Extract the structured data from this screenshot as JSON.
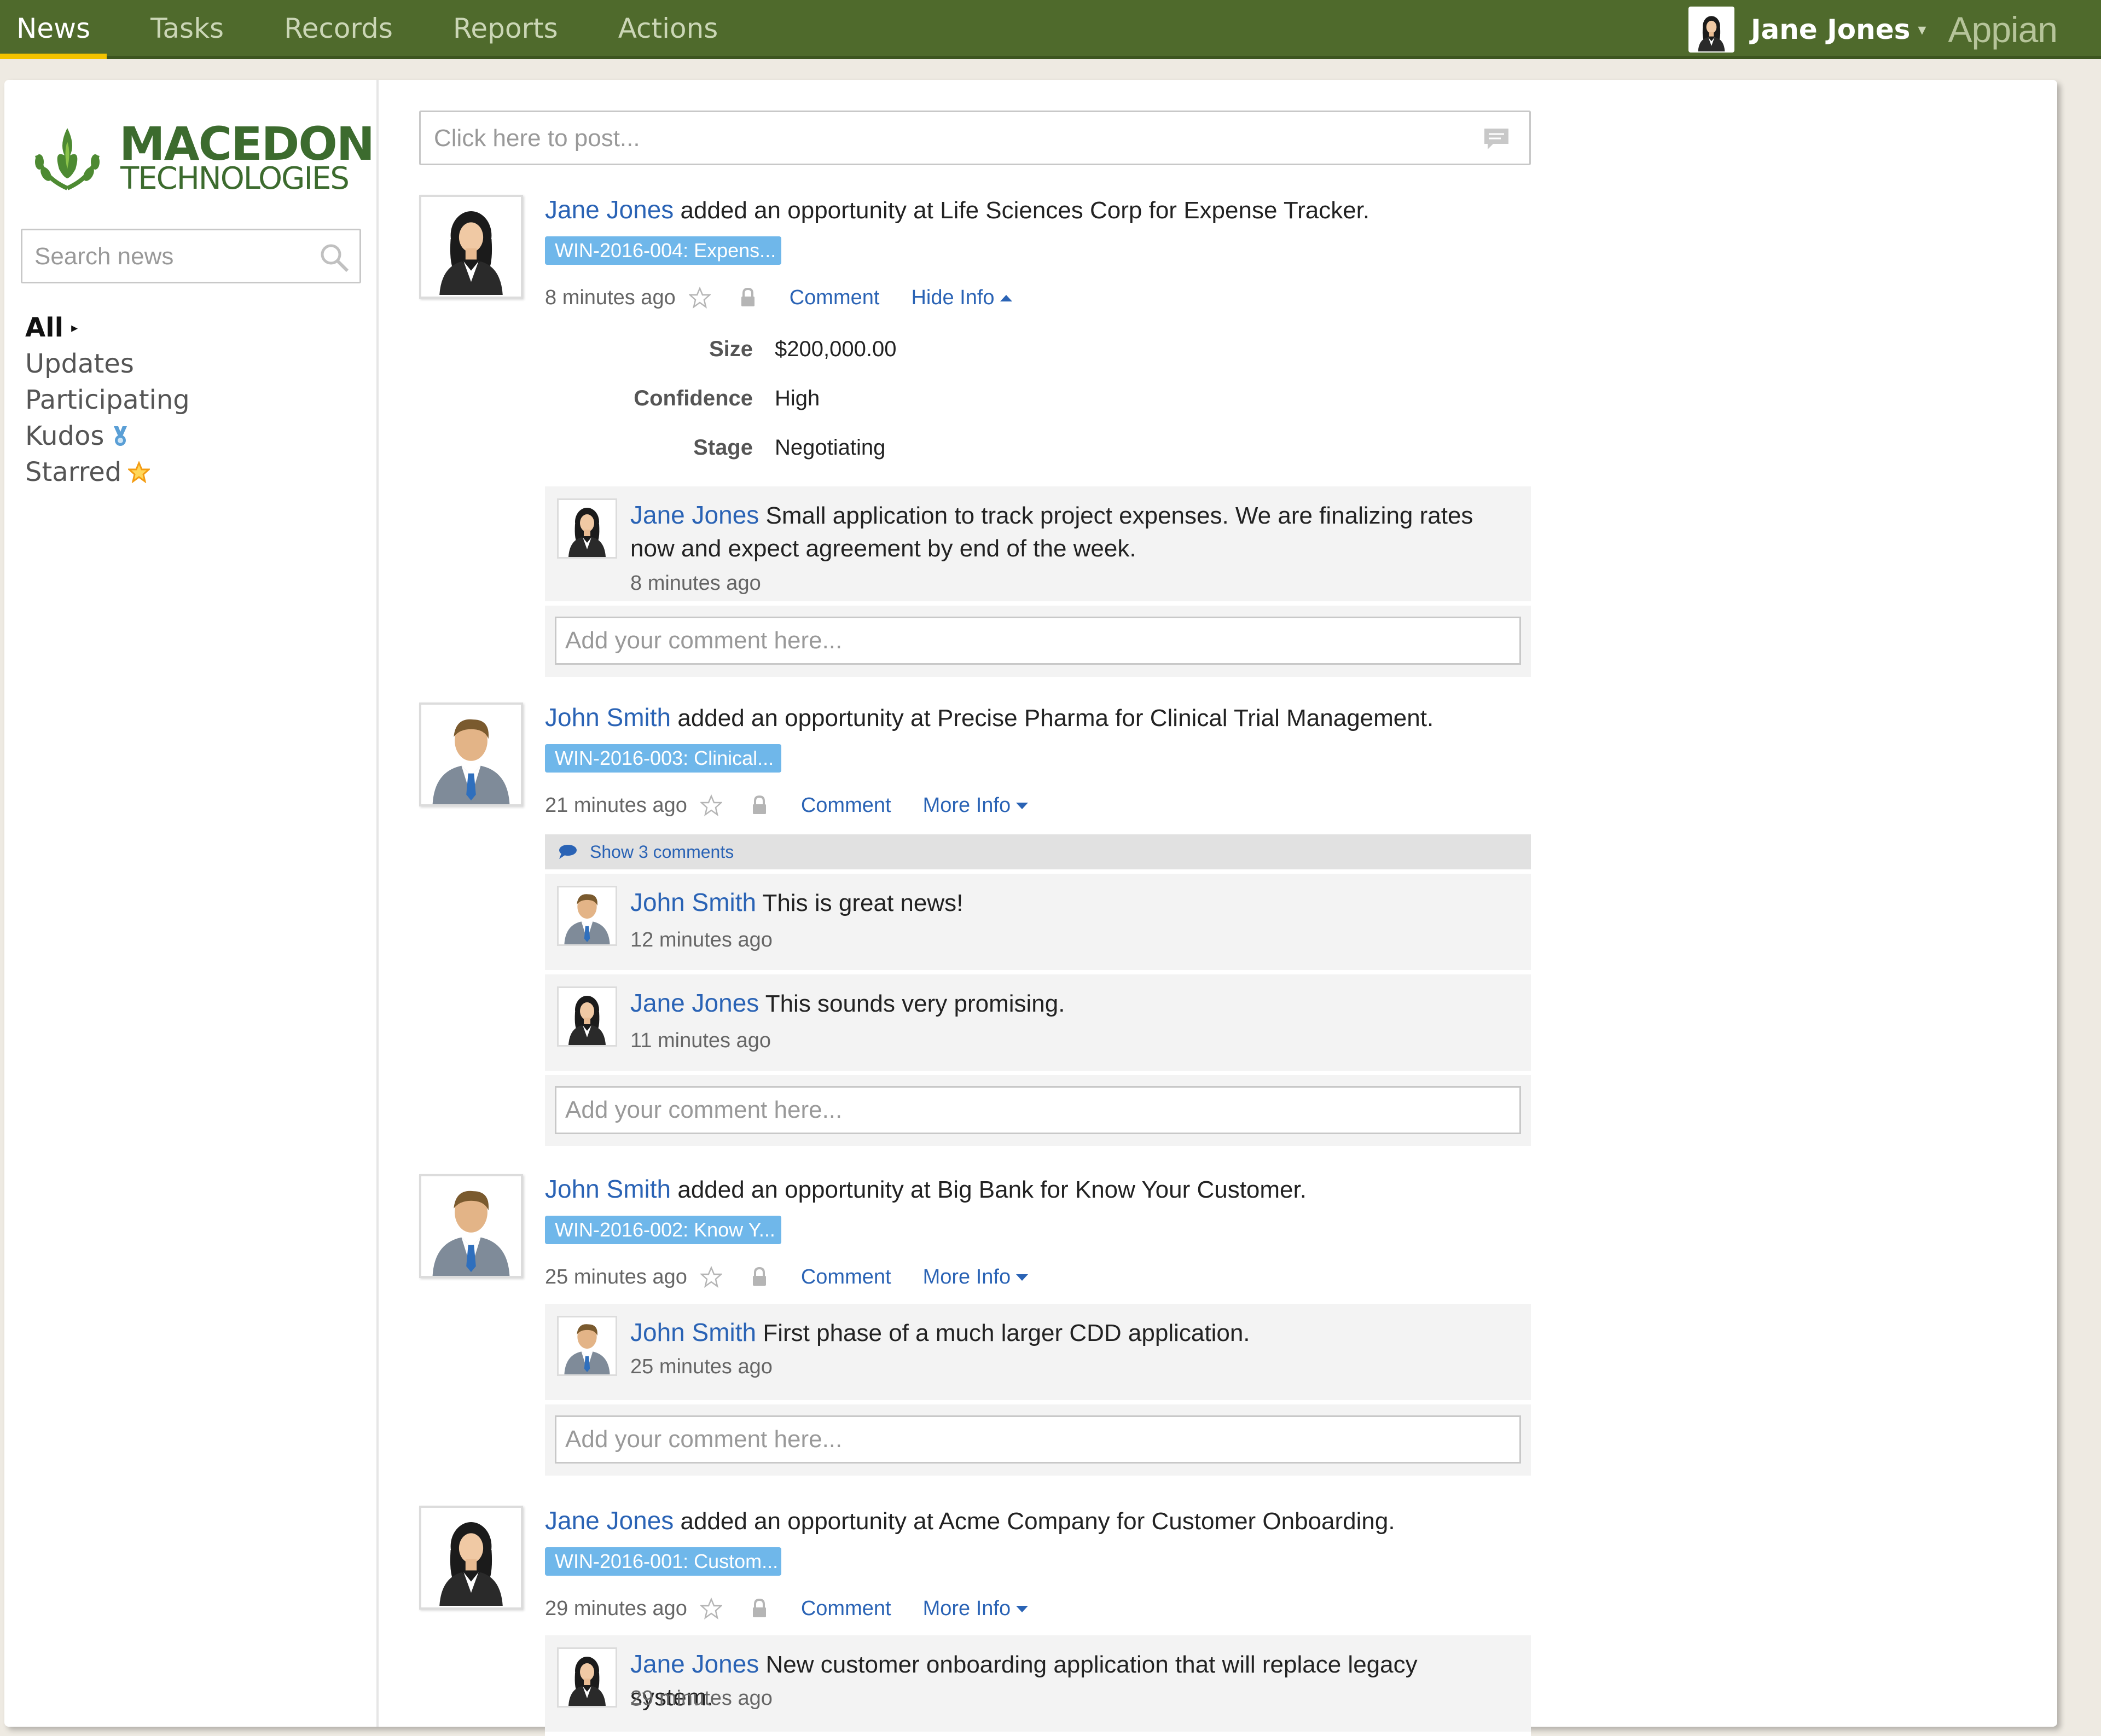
{
  "topbar": {
    "tabs": [
      {
        "label": "News",
        "active": true
      },
      {
        "label": "Tasks"
      },
      {
        "label": "Records"
      },
      {
        "label": "Reports"
      },
      {
        "label": "Actions"
      }
    ],
    "user_name": "Jane Jones",
    "user_caret": "▾",
    "brand": "Appian",
    "bar_color": "#4f6a2c",
    "active_indicator_color": "#f2c300"
  },
  "sidebar": {
    "logo_line1": "MACEDON",
    "logo_line2": "TECHNOLOGIES",
    "search_placeholder": "Search news",
    "filters": [
      {
        "label": "All",
        "active": true,
        "marker": "▸"
      },
      {
        "label": "Updates"
      },
      {
        "label": "Participating"
      },
      {
        "label": "Kudos",
        "icon": "medal-icon"
      },
      {
        "label": "Starred",
        "icon": "star-icon"
      }
    ]
  },
  "feed": {
    "post_placeholder": "Click here to post...",
    "comment_placeholder": "Add your comment here...",
    "entries": [
      {
        "author": "Jane Jones",
        "text": " added an opportunity at Life Sciences Corp for Expense Tracker.",
        "tag": "WIN-2016-004: Expens...",
        "time": "8 minutes ago",
        "comment_link": "Comment",
        "info_link": "Hide Info",
        "info": [
          {
            "label": "Size",
            "value": "$200,000.00"
          },
          {
            "label": "Confidence",
            "value": "High"
          },
          {
            "label": "Stage",
            "value": "Negotiating"
          }
        ],
        "comments": [
          {
            "author": "Jane Jones",
            "text": " Small application to track project expenses.  We are finalizing rates now and expect agreement by end of the week.",
            "time": "8 minutes ago"
          }
        ]
      },
      {
        "author": "John Smith",
        "text": " added an opportunity at Precise Pharma for Clinical Trial Management.",
        "tag": "WIN-2016-003: Clinical...",
        "time": "21 minutes ago",
        "comment_link": "Comment",
        "info_link": "More Info",
        "show_comments": "Show 3 comments",
        "comments": [
          {
            "author": "John Smith",
            "text": " This is great news!",
            "time": "12 minutes ago"
          },
          {
            "author": "Jane Jones",
            "text": " This sounds very promising.",
            "time": "11 minutes ago"
          }
        ]
      },
      {
        "author": "John Smith",
        "text": " added an opportunity at Big Bank for Know Your Customer.",
        "tag": "WIN-2016-002: Know Y...",
        "time": "25 minutes ago",
        "comment_link": "Comment",
        "info_link": "More Info",
        "comments": [
          {
            "author": "John Smith",
            "text": " First phase of a much larger CDD application.",
            "time": "25 minutes ago"
          }
        ]
      },
      {
        "author": "Jane Jones",
        "text": " added an opportunity at Acme Company for Customer Onboarding.",
        "tag": "WIN-2016-001: Custom...",
        "time": "29 minutes ago",
        "comment_link": "Comment",
        "info_link": "More Info",
        "comments": [
          {
            "author": "Jane Jones",
            "text": " New customer onboarding application that will replace legacy system.",
            "time": "29 minutes ago"
          }
        ]
      }
    ]
  }
}
